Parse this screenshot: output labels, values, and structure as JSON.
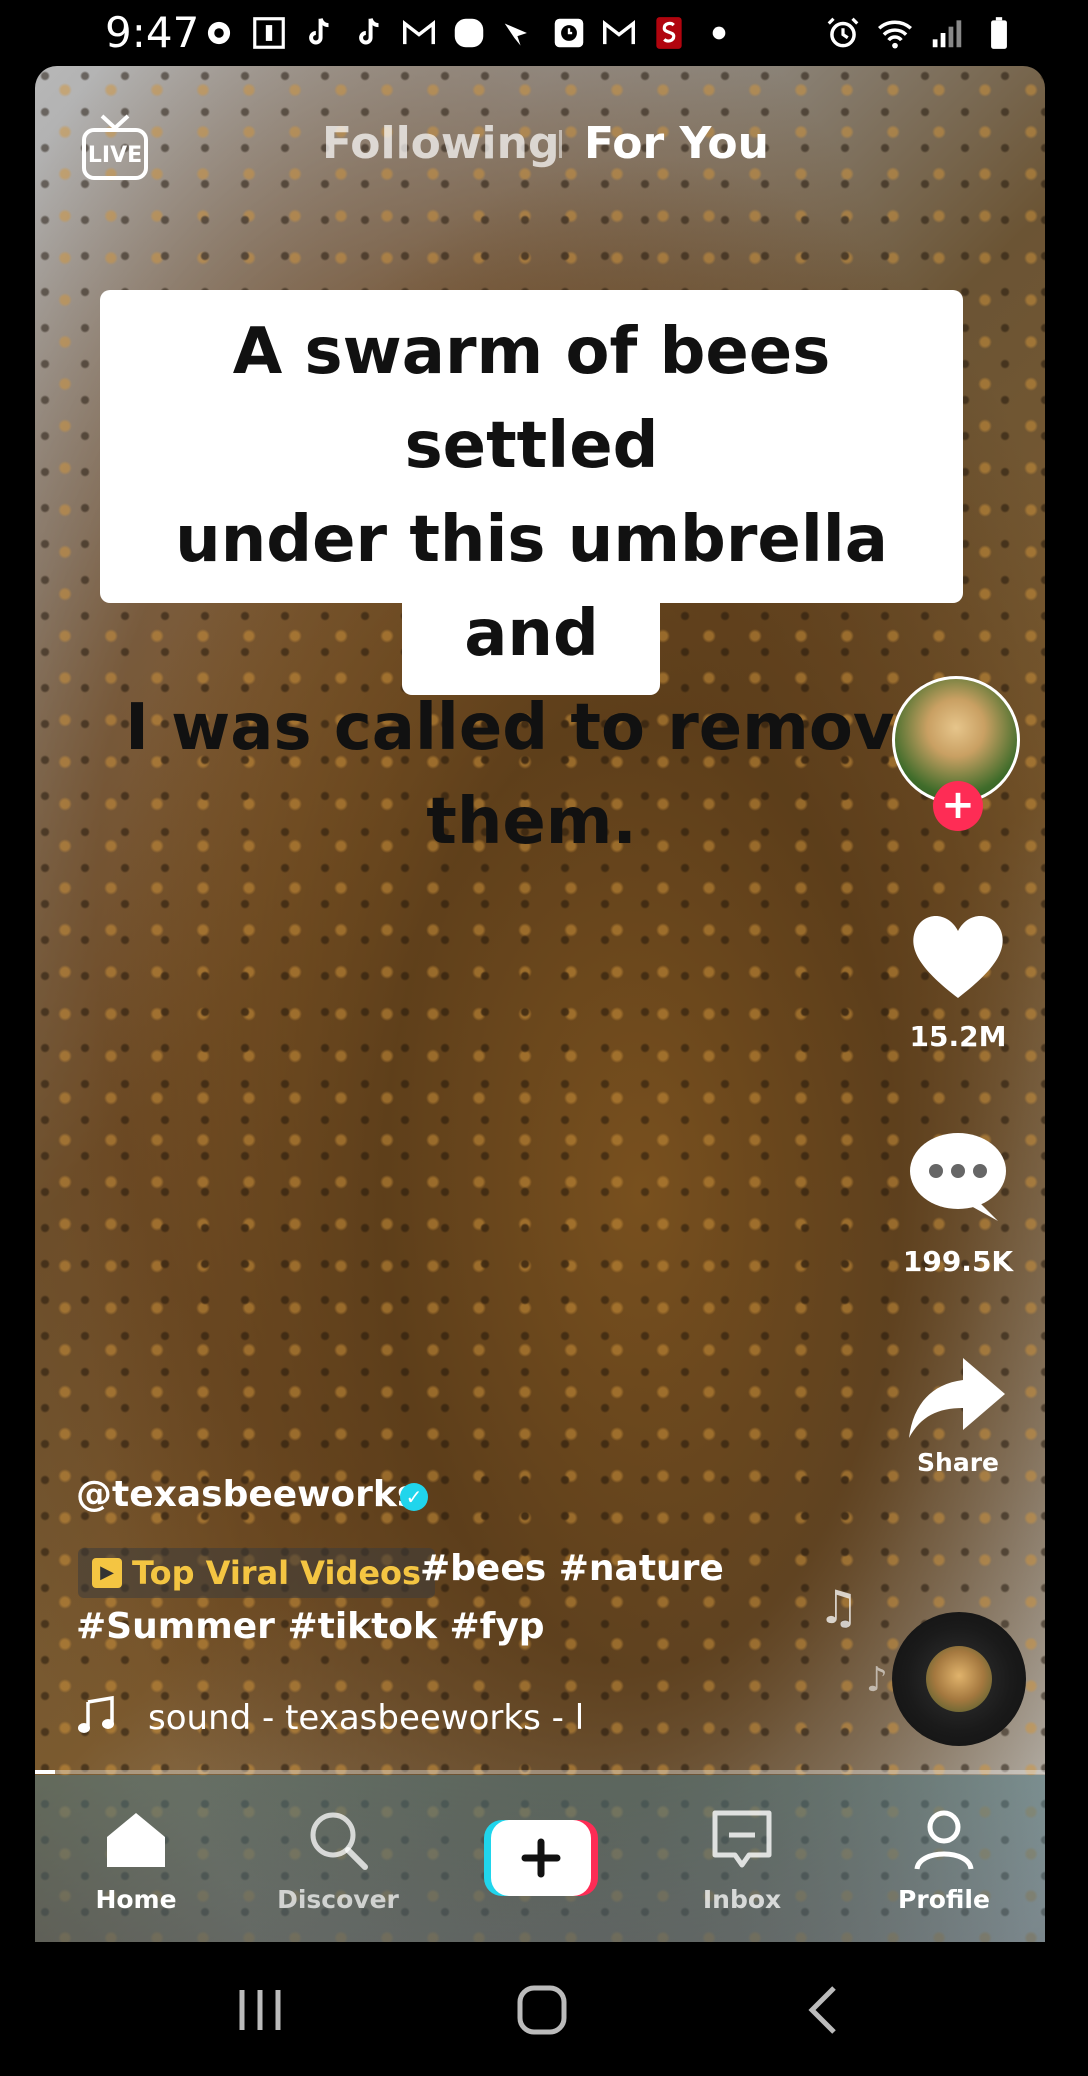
{
  "status_bar": {
    "time": "9:47",
    "left_icons": [
      "settings-icon",
      "image-icon",
      "tiktok-icon",
      "tiktok-icon",
      "gmail-icon",
      "blob-icon",
      "bird-icon",
      "clock-app-icon",
      "gmail-icon",
      "stanford-icon",
      "dot-icon"
    ],
    "right_icons": [
      "alarm-icon",
      "wifi-icon",
      "signal-icon",
      "battery-icon"
    ]
  },
  "top_tabs": {
    "live_label": "LIVE",
    "following": "Following",
    "for_you": "For You"
  },
  "caption": {
    "line1": "A swarm of bees settled",
    "line2": "under this umbrella and",
    "line3": "I was called to remove",
    "line4": "them."
  },
  "rail": {
    "likes": "15.2M",
    "comments": "199.5K",
    "share_label": "Share"
  },
  "info": {
    "username": "@texasbeeworks",
    "playlist_label": "Top Viral Videos",
    "hashtags_line1": "#bees #nature",
    "hashtags_line2": "#Summer #tiktok #fyp",
    "sound": "sound - texasbeeworks - l"
  },
  "progress_fraction": 0.02,
  "nav": {
    "home": "Home",
    "discover": "Discover",
    "inbox": "Inbox",
    "profile": "Profile"
  },
  "colors": {
    "accent_red": "#fe2c55",
    "accent_cyan": "#20d5ec",
    "playlist_yellow": "#f4c542"
  }
}
